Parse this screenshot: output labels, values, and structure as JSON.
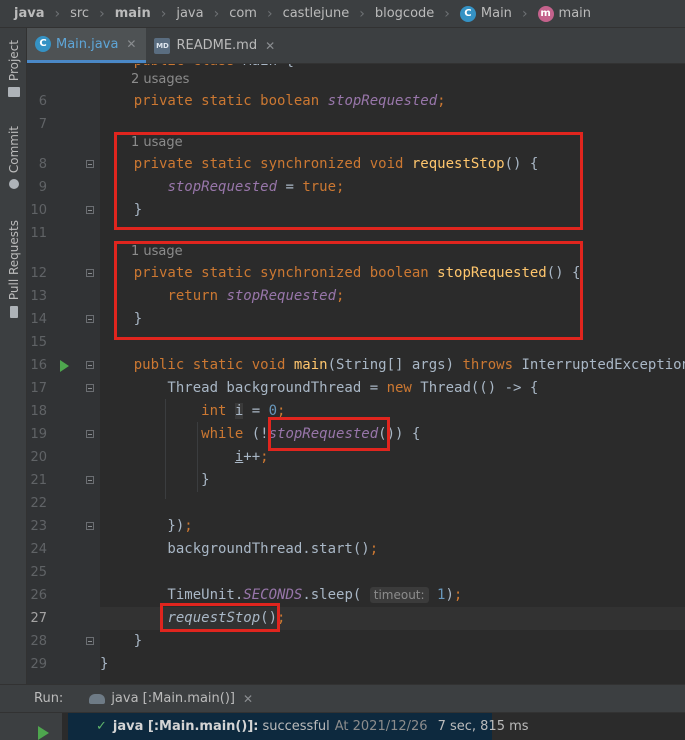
{
  "breadcrumb": {
    "items": [
      "java",
      "src",
      "main",
      "java",
      "com",
      "castlejune",
      "blogcode",
      "Main",
      "main"
    ]
  },
  "tool_windows": {
    "project": "Project",
    "commit": "Commit",
    "pull_requests": "Pull Requests"
  },
  "tabs": [
    {
      "label": "Main.java",
      "active": true,
      "icon": "java-class-icon"
    },
    {
      "label": "README.md",
      "active": false,
      "icon": "markdown-file-icon"
    }
  ],
  "editor": {
    "usage_hints": {
      "stop_requested_field": "2 usages",
      "request_stop": "1 usage",
      "stop_requested_method": "1 usage"
    },
    "timeout_hint": "timeout:",
    "lines": [
      {
        "n": "6"
      },
      {
        "n": "7"
      },
      {
        "n": "8"
      },
      {
        "n": "9"
      },
      {
        "n": "10"
      },
      {
        "n": "11"
      },
      {
        "n": "12"
      },
      {
        "n": "13"
      },
      {
        "n": "14"
      },
      {
        "n": "15"
      },
      {
        "n": "16"
      },
      {
        "n": "17"
      },
      {
        "n": "18"
      },
      {
        "n": "19"
      },
      {
        "n": "20"
      },
      {
        "n": "21"
      },
      {
        "n": "22"
      },
      {
        "n": "23"
      },
      {
        "n": "24"
      },
      {
        "n": "25"
      },
      {
        "n": "26"
      },
      {
        "n": "27"
      },
      {
        "n": "28"
      },
      {
        "n": "29"
      }
    ],
    "current_line": "27"
  },
  "run": {
    "label": "Run:",
    "tab_label": "java [:Main.main()]",
    "result_target": "java [:Main.main()]:",
    "result_status": "successful",
    "result_time": "At 2021/12/26",
    "result_duration": "7 sec, 815 ms"
  },
  "colors": {
    "keyword": "#cc7832",
    "method": "#ffc66d",
    "field": "#9876aa",
    "number": "#6897bb",
    "highlight_box": "#e0251e",
    "run_green": "#4ea64e"
  }
}
